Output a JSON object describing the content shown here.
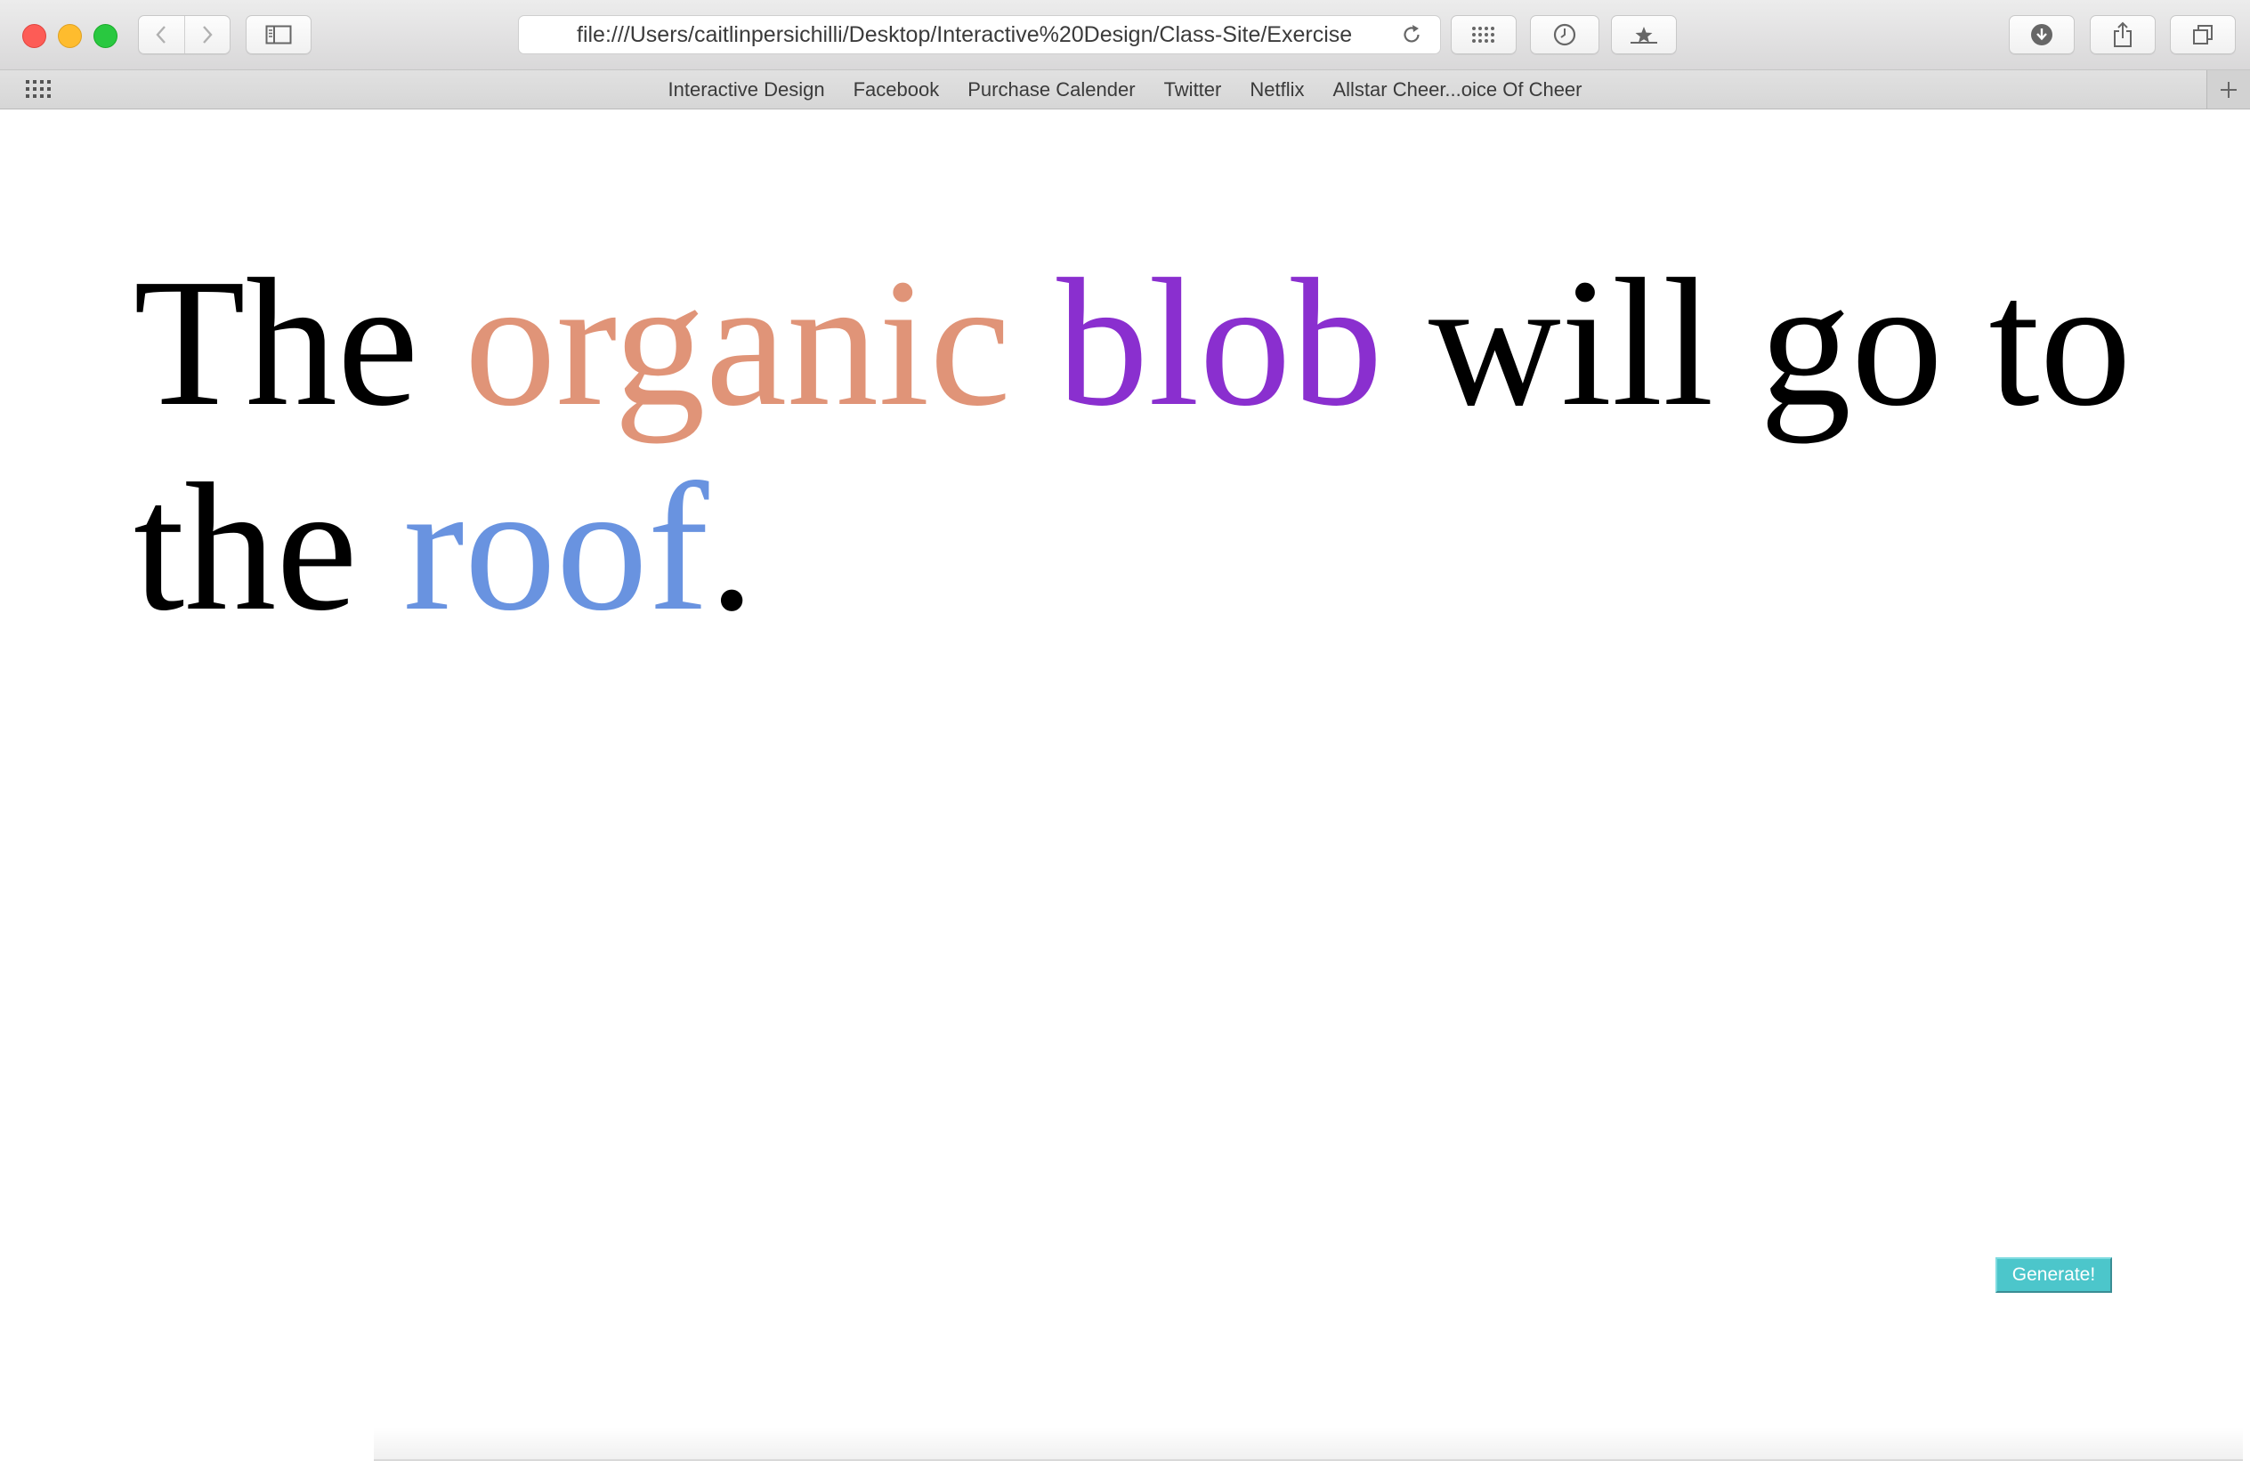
{
  "browser": {
    "url": "file:///Users/caitlinpersichilli/Desktop/Interactive%20Design/Class-Site/Exercise",
    "bookmarks": [
      {
        "label": "Interactive Design"
      },
      {
        "label": "Facebook"
      },
      {
        "label": "Purchase Calender"
      },
      {
        "label": "Twitter"
      },
      {
        "label": "Netflix"
      },
      {
        "label": "Allstar Cheer...oice Of Cheer"
      }
    ],
    "icons": {
      "back": "chevron-left-icon",
      "forward": "chevron-right-icon",
      "sidebar": "sidebar-icon",
      "reload": "reload-icon",
      "top_sites": "grid-icon",
      "history": "clock-icon",
      "bookmark": "star-icon",
      "downloads": "download-icon",
      "share": "share-icon",
      "tabs": "tabs-icon",
      "add_bookmark": "plus-icon"
    }
  },
  "page": {
    "sentence": {
      "w1": "The",
      "w2": "organic",
      "w3": "blob",
      "w4": "will go to the",
      "w5": "roof",
      "w6": "."
    },
    "colors": {
      "organic": "#e09478",
      "blob": "#8a2fcf",
      "roof": "#6993e0",
      "button": "#4cc6cb"
    },
    "generate_button": "Generate!"
  }
}
